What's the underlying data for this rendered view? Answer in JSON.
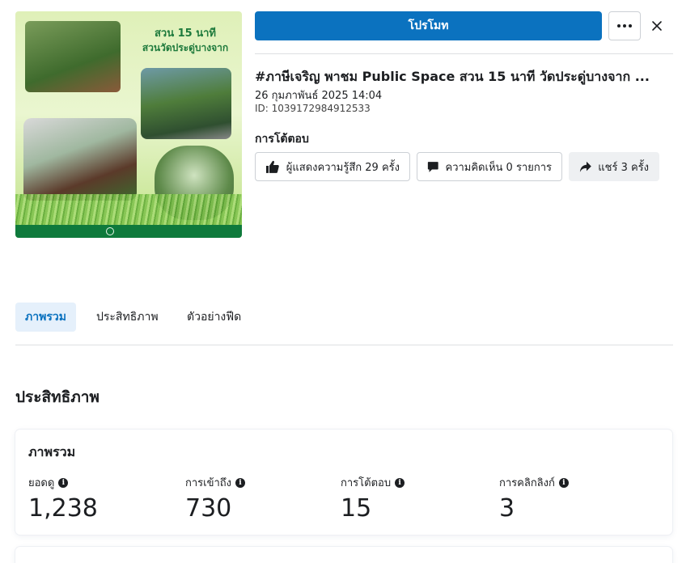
{
  "post": {
    "thumbnail_caption_line1": "สวน 15 นาที",
    "thumbnail_caption_line2": "สวนวัดประดู่บางจาก",
    "title": "#ภาษีเจริญ พาชม Public Space สวน 15 นาที วัดประดู่บางจาก ...",
    "date": "26 กุมภาพันธ์ 2025 14:04",
    "id": "ID: 1039172984912533"
  },
  "header": {
    "promote_label": "โปรโมท"
  },
  "engagement": {
    "title": "การโต้ตอบ",
    "reactions_label": "ผู้แสดงความรู้สึก 29 ครั้ง",
    "comments_label": "ความคิดเห็น 0 รายการ",
    "shares_label": "แชร์ 3 ครั้ง"
  },
  "tabs": [
    {
      "label": "ภาพรวม",
      "active": true
    },
    {
      "label": "ประสิทธิภาพ",
      "active": false
    },
    {
      "label": "ตัวอย่างฟีด",
      "active": false
    }
  ],
  "performance": {
    "section_title": "ประสิทธิภาพ",
    "overview_title": "ภาพรวม",
    "metrics": [
      {
        "label": "ยอดดู",
        "value": "1,238"
      },
      {
        "label": "การเข้าถึง",
        "value": "730"
      },
      {
        "label": "การโต้ตอบ",
        "value": "15"
      },
      {
        "label": "การคลิกลิงก์",
        "value": "3"
      }
    ]
  },
  "colors": {
    "primary": "#0b72bf",
    "active_tab_bg": "#e5f0fb",
    "text": "#1c1e21"
  }
}
